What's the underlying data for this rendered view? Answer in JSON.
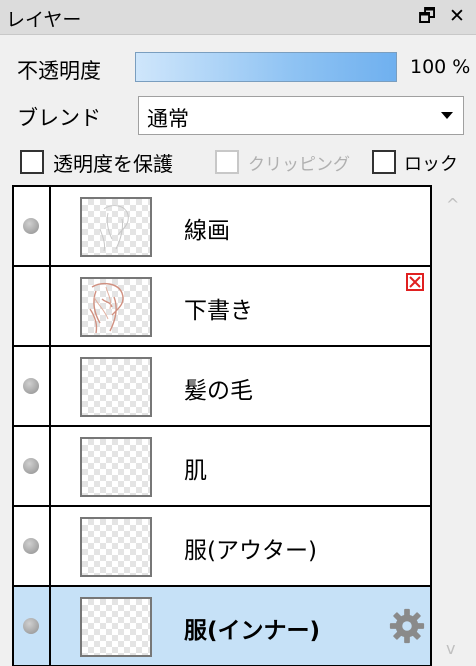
{
  "panel": {
    "title": "レイヤー",
    "float_glyph": "🗗",
    "close_glyph": "✕"
  },
  "opacity": {
    "label": "不透明度",
    "value_text": "100 %",
    "value_fraction": 1.0
  },
  "blend": {
    "label": "ブレンド",
    "selected": "通常"
  },
  "options": {
    "protect_alpha": {
      "label": "透明度を保護",
      "checked": false,
      "enabled": true
    },
    "clipping": {
      "label": "クリッピング",
      "checked": false,
      "enabled": false
    },
    "lock": {
      "label": "ロック",
      "checked": false,
      "enabled": true
    }
  },
  "layers": [
    {
      "name": "線画",
      "visible": true,
      "selected": false,
      "thumb": "sketch-gray"
    },
    {
      "name": "下書き",
      "visible": false,
      "selected": false,
      "thumb": "sketch-red",
      "badge": "mask-red-x-icon"
    },
    {
      "name": "髪の毛",
      "visible": true,
      "selected": false,
      "thumb": "empty"
    },
    {
      "name": "肌",
      "visible": true,
      "selected": false,
      "thumb": "empty"
    },
    {
      "name": "服(アウター)",
      "visible": true,
      "selected": false,
      "thumb": "empty"
    },
    {
      "name": "服(インナー)",
      "visible": true,
      "selected": true,
      "thumb": "empty",
      "badge": "gear-icon"
    }
  ],
  "scroll": {
    "up": "^",
    "down": "v"
  },
  "colors": {
    "selected_row": "#c6e1f7",
    "opacity_bar": "#6fb0ef",
    "mask_badge": "#e02020"
  }
}
